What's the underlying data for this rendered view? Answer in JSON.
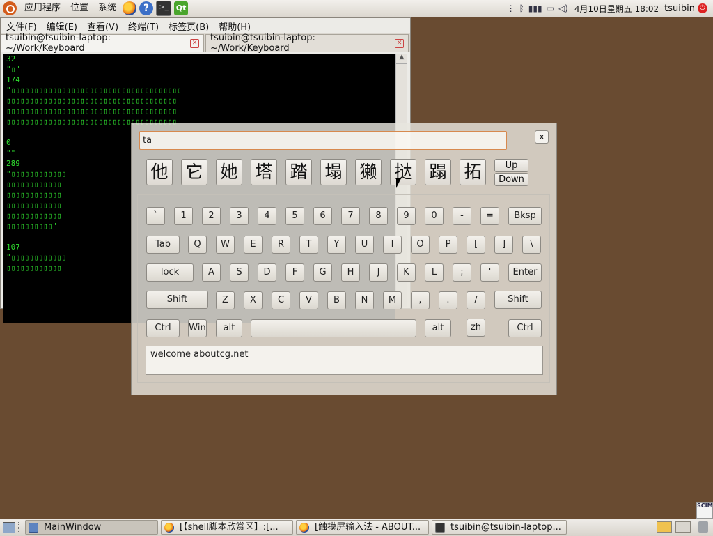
{
  "top_panel": {
    "menus": [
      "应用程序",
      "位置",
      "系统"
    ],
    "launchers": [
      "firefox-icon",
      "help-icon",
      "terminal-icon",
      "qt-icon"
    ],
    "clock": "4月10日星期五 18:02",
    "user": "tsuibin"
  },
  "terminal": {
    "menus": [
      "文件(F)",
      "编辑(E)",
      "查看(V)",
      "终端(T)",
      "标签页(B)",
      "帮助(H)"
    ],
    "tabs": [
      {
        "label": "tsuibin@tsuibin-laptop: ~/Work/Keyboard"
      },
      {
        "label": "tsuibin@tsuibin-laptop: ~/Work/Keyboard"
      }
    ],
    "output": "32\n\"▯\"\n174\n\"▯▯▯▯▯▯▯▯▯▯▯▯▯▯▯▯▯▯▯▯▯▯▯▯▯▯▯▯▯▯▯▯▯▯▯▯▯\n▯▯▯▯▯▯▯▯▯▯▯▯▯▯▯▯▯▯▯▯▯▯▯▯▯▯▯▯▯▯▯▯▯▯▯▯▯\n▯▯▯▯▯▯▯▯▯▯▯▯▯▯▯▯▯▯▯▯▯▯▯▯▯▯▯▯▯▯▯▯▯▯▯▯▯\n▯▯▯▯▯▯▯▯▯▯▯▯▯▯▯▯▯▯▯▯▯▯▯▯▯▯▯▯▯▯▯▯▯▯▯▯▯\n\n0\n\"\"\n289\n\"▯▯▯▯▯▯▯▯▯▯▯▯\n▯▯▯▯▯▯▯▯▯▯▯▯\n▯▯▯▯▯▯▯▯▯▯▯▯\n▯▯▯▯▯▯▯▯▯▯▯▯\n▯▯▯▯▯▯▯▯▯▯▯▯\n▯▯▯▯▯▯▯▯▯▯\"\n\n107\n\"▯▯▯▯▯▯▯▯▯▯▯▯\n▯▯▯▯▯▯▯▯▯▯▯▯"
  },
  "keyboard": {
    "pinyin": "ta",
    "close_label": "x",
    "candidates": [
      "他",
      "它",
      "她",
      "塔",
      "踏",
      "塌",
      "獭",
      "挞",
      "蹋",
      "拓"
    ],
    "up_label": "Up",
    "down_label": "Down",
    "rows": [
      [
        "`",
        "1",
        "2",
        "3",
        "4",
        "5",
        "6",
        "7",
        "8",
        "9",
        "0",
        "-",
        "=",
        "Bksp"
      ],
      [
        "Tab",
        "Q",
        "W",
        "E",
        "R",
        "T",
        "Y",
        "U",
        "I",
        "O",
        "P",
        "[",
        "]",
        "\\"
      ],
      [
        "lock",
        "A",
        "S",
        "D",
        "F",
        "G",
        "H",
        "J",
        "K",
        "L",
        ";",
        "'",
        "Enter"
      ],
      [
        "Shift",
        "Z",
        "X",
        "C",
        "V",
        "B",
        "N",
        "M",
        ",",
        ".",
        "/",
        "Shift"
      ],
      [
        "Ctrl",
        "Win",
        "alt",
        "",
        "alt",
        "zh",
        "Ctrl"
      ]
    ],
    "output_text": "welcome aboutcg.net"
  },
  "taskbar": {
    "tasks": [
      {
        "label": "MainWindow",
        "icon": "window-icon"
      },
      {
        "label": "[【shell脚本欣赏区】:[...",
        "icon": "firefox-icon"
      },
      {
        "label": "[触摸屏输入法 - ABOUT...",
        "icon": "firefox-icon"
      },
      {
        "label": "tsuibin@tsuibin-laptop...",
        "icon": "terminal-icon"
      }
    ]
  },
  "scim_label": "SCIM",
  "colors": {
    "desktop": "#694b31",
    "terminal_text": "#2fdf2f",
    "focus_border": "#d7894e"
  }
}
